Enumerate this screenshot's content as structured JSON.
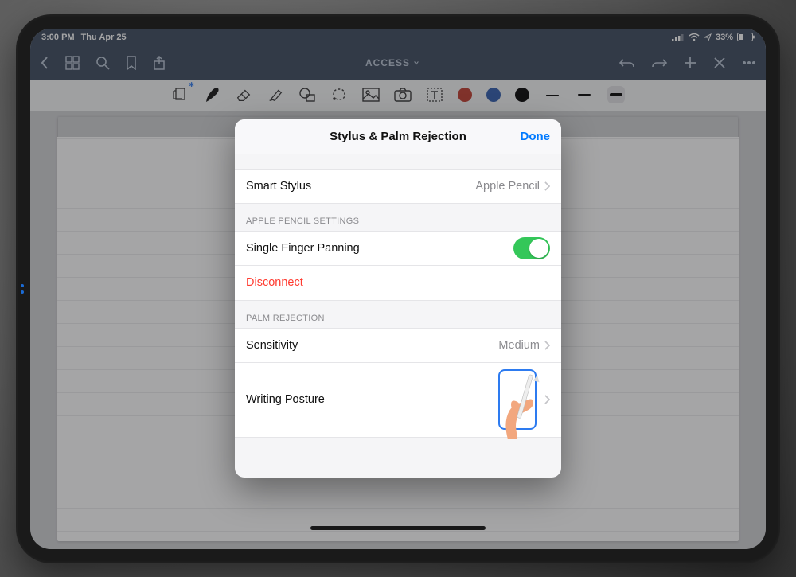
{
  "status": {
    "time": "3:00 PM",
    "date": "Thu Apr 25",
    "battery_pct": "33%"
  },
  "nav": {
    "title": "ACCESS"
  },
  "modal": {
    "title": "Stylus & Palm Rejection",
    "done_label": "Done",
    "rows": {
      "smart_stylus_label": "Smart Stylus",
      "smart_stylus_value": "Apple Pencil",
      "section_apple_pencil": "Apple Pencil Settings",
      "single_finger_panning_label": "Single Finger Panning",
      "single_finger_panning_on": true,
      "disconnect_label": "Disconnect",
      "section_palm_rejection": "Palm Rejection",
      "sensitivity_label": "Sensitivity",
      "sensitivity_value": "Medium",
      "writing_posture_label": "Writing Posture"
    }
  }
}
